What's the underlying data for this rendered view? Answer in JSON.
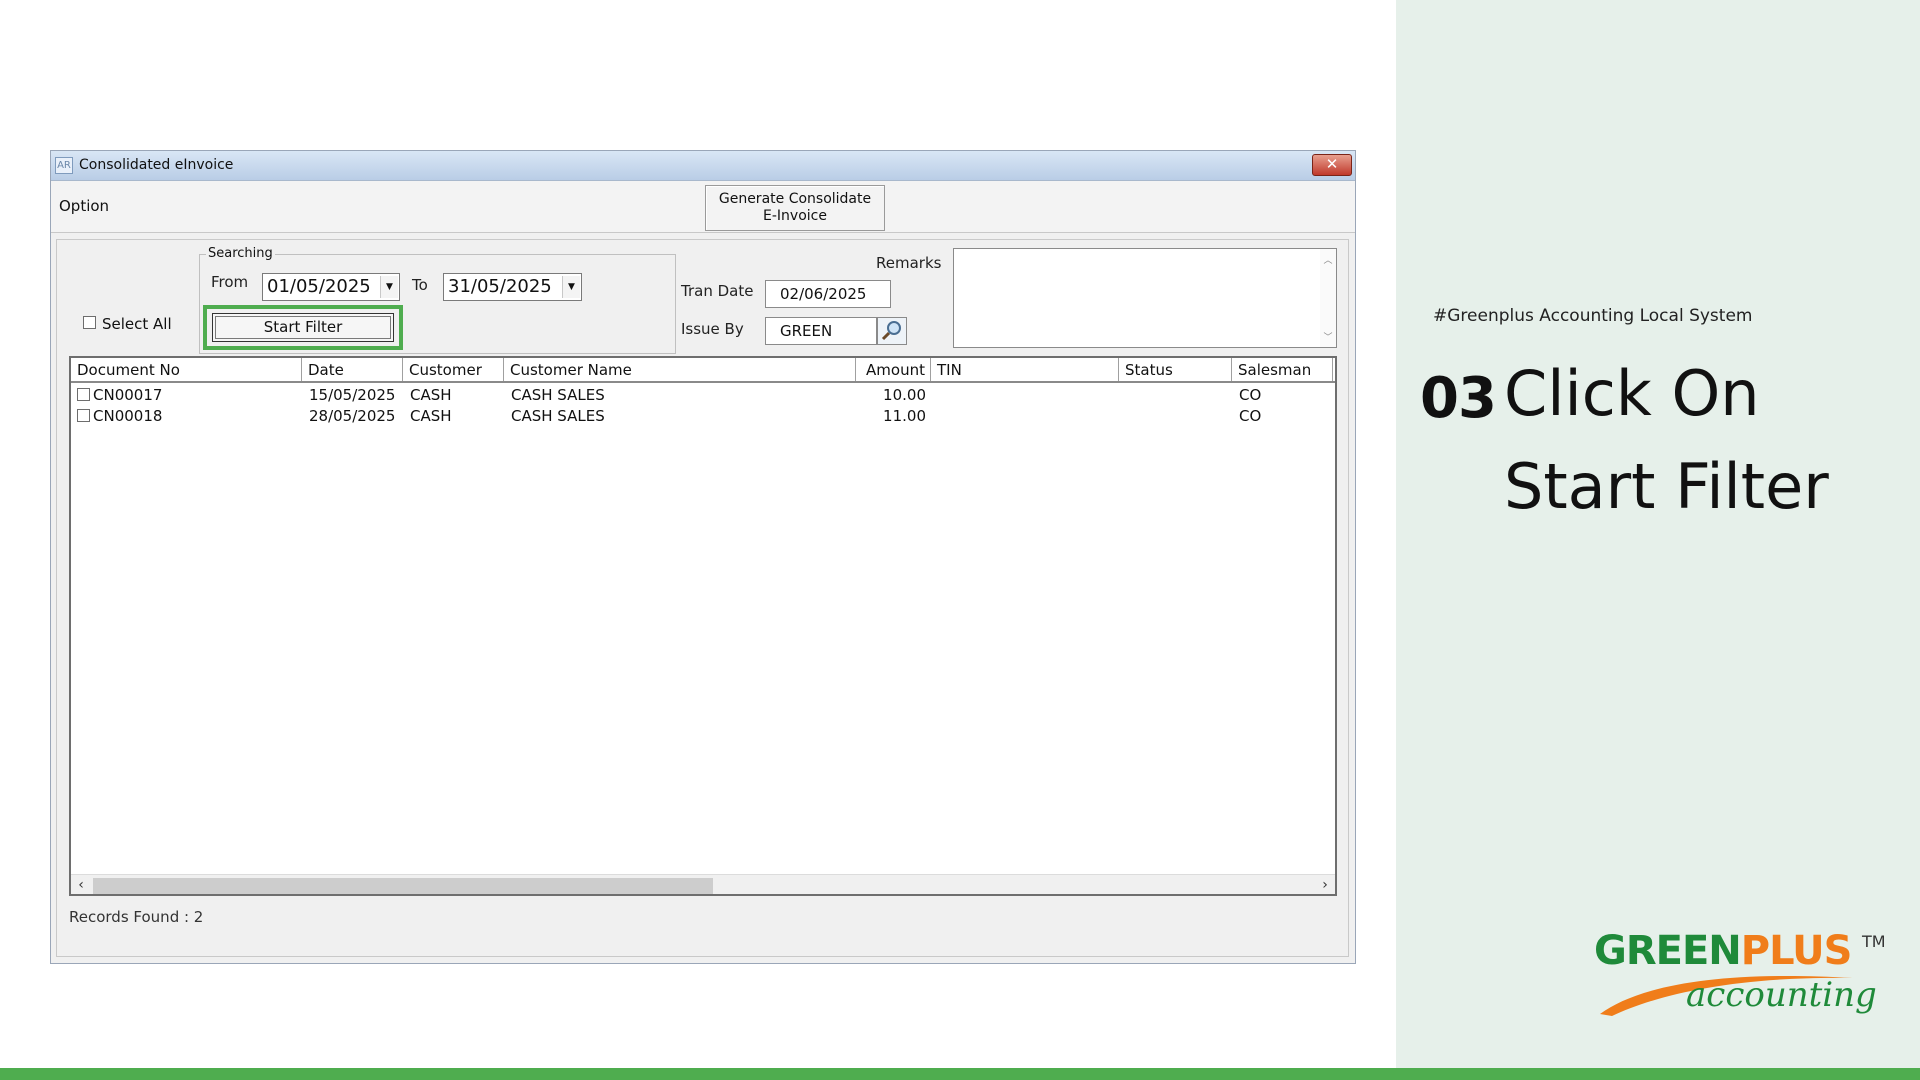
{
  "window": {
    "title": "Consolidated eInvoice",
    "app_icon": "AR",
    "close": "✕",
    "option_label": "Option",
    "generate_button": "Generate Consolidate\nE-Invoice"
  },
  "filters": {
    "select_all_label": "Select All",
    "group_label": "Searching",
    "from_label": "From",
    "from_value": "01/05/2025",
    "to_label": "To",
    "to_value": "31/05/2025",
    "start_filter_label": "Start Filter",
    "tran_date_label": "Tran Date",
    "tran_date_value": "02/06/2025",
    "issue_by_label": "Issue By",
    "issue_by_value": "GREEN",
    "remarks_label": "Remarks"
  },
  "grid": {
    "columns": [
      "Document No",
      "Date",
      "Customer",
      "Customer Name",
      "Amount",
      "TIN",
      "Status",
      "Salesman"
    ],
    "rows": [
      {
        "doc": "CN00017",
        "date": "15/05/2025",
        "customer": "CASH",
        "name": "CASH SALES",
        "amount": "10.00",
        "tin": "",
        "status": "",
        "salesman": "CO"
      },
      {
        "doc": "CN00018",
        "date": "28/05/2025",
        "customer": "CASH",
        "name": "CASH SALES",
        "amount": "11.00",
        "tin": "",
        "status": "",
        "salesman": "CO"
      }
    ],
    "records_found": "Records Found : 2"
  },
  "instruction": {
    "hashtag": "#Greenplus Accounting Local System",
    "step_number": "03",
    "line1": "Click On",
    "line2": "Start Filter"
  },
  "logo": {
    "part1": "GREEN",
    "part2": "PLUS",
    "tm": "TM",
    "sub": "accounting"
  },
  "colors": {
    "highlight": "#4fad4f",
    "brand_green": "#1f8a3a",
    "brand_orange": "#f07d1a",
    "panel_bg": "#e6f0ea"
  }
}
